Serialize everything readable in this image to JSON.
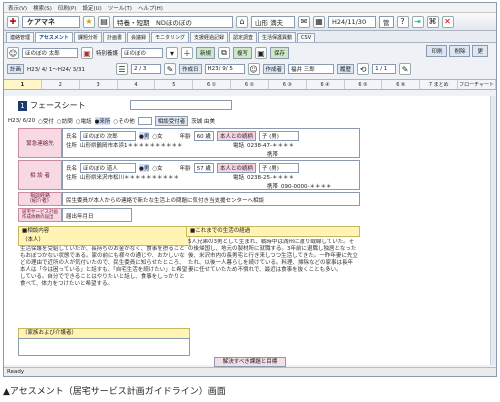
{
  "menubar": [
    "表示(V)",
    "検索(S)",
    "印刷(P)",
    "設定(U)",
    "ツール(T)",
    "ヘルプ(H)"
  ],
  "toolbar": {
    "app_title": "ケアマネ",
    "context": "特養・短期　NDほのぼの",
    "user": "山形 満夫",
    "date": "H24/11/30",
    "status": "管"
  },
  "func_tabs": [
    "連絡管理",
    "アセスメント",
    "課題分析",
    "計画書",
    "会議録",
    "モニタリング",
    "支援経過記録",
    "認定調査",
    "生活保護異動",
    "CSV"
  ],
  "actions": {
    "print": "印刷",
    "delete": "削除",
    "save": "更"
  },
  "row1": {
    "name_tag": "ほのぼの 太郎",
    "care_label": "特別養護",
    "facility": "ほのぼの",
    "new": "新規",
    "copy": "複写",
    "save": "保存"
  },
  "row2": {
    "period_label": "計画",
    "period": "H23/ 4/ 1～H24/ 3/31",
    "page": "2 / 3",
    "created_label": "作成日",
    "created": "H23/ 9/ 5",
    "author_label": "作成者",
    "author": "福井 三郎",
    "history": "履歴",
    "count": "1 / 1"
  },
  "num_tabs": [
    "1",
    "2",
    "3",
    "4",
    "5",
    "6 ①",
    "6 ②",
    "6 ③",
    "6 ④",
    "6 ⑤",
    "6 ⑥",
    "7 まとめ",
    "フローチャート"
  ],
  "sheet": {
    "title": "フェースシート",
    "date": "H23/ 6/20",
    "receipt": "受付",
    "visit": "訪問",
    "phone": "電話",
    "office": "来所",
    "other": "その他",
    "consult_label": "相談受付者",
    "consult": "茨城 由美"
  },
  "contact1": {
    "label": "緊急連絡先",
    "name_label": "氏名",
    "name": "ほのぼの 次郎",
    "male": "男",
    "female": "女",
    "age_label": "年齢",
    "age": "60 歳",
    "rel_label": "本人との続柄",
    "rel": "子 (男)",
    "addr_label": "住所",
    "addr": "山形県鶴岡市本浜1＊＊＊＊＊＊＊＊＊＊",
    "tel_label": "電話",
    "tel": "0238-47-＊＊＊＊",
    "mobile_label": "携帯"
  },
  "contact2": {
    "label": "相 談 者",
    "name_label": "氏名",
    "name": "ほのぼの 道人",
    "male": "男",
    "female": "女",
    "age_label": "年齢",
    "age": "57 歳",
    "rel_label": "本人との続柄",
    "rel": "子 (男)",
    "addr_label": "住所",
    "addr": "山形県米沢市松川＊＊＊＊＊＊＊＊＊＊",
    "tel_label": "電話",
    "tel": "0238-25-＊＊＊＊",
    "mobile_label": "携帯",
    "mobile": "090-0000-＊＊＊＊"
  },
  "route": {
    "label": "相談経路\n(紹介者)",
    "text": "民生委員が本人からの連絡で新たな生活上の問題に気付き当支援センターへ相談"
  },
  "date_field": {
    "label": "居宅サービス計画\n作成依頼の届出",
    "value": "届出年月日"
  },
  "consult_detail": {
    "header": "■相談内容",
    "sub": "（本人）",
    "text": "生活保護を受給していたが、長持ちのお金がなく、食事を摂ることもおぼつかない状態である。家の前にも様々の通じや、おかしいなどの理由で近所の人が気付いたので、民生委員に知らせたところ、本人は「今は困っている」と話すも、「自宅生活を続けたい」と希望している。自分でできることはやりたいと話し、食事をしっかりと食べて、体力をつけたいと希望する。",
    "family_header": "（家族および介護者）"
  },
  "history_section": {
    "header": "■これまでの生活の経過",
    "text": "5人兄弟の3男として生まれ、戦時中は満州に渡り戦線していた。その後帰国し、地元の製材所に就職する。3年前に退職し独居となった後、米沢市内の長男宅と行き来しつつ生活してきた。一昨年妻に先立たれ、以後一人暮らしを続けている。料理、掃除などの家事は長年妻に任せていたため不慣れで、最近は食事を抜くことも多い。"
  },
  "bottom": {
    "button": "解決すべき課題と目標"
  },
  "status": "Ready",
  "caption": "▲アセスメント（居宅サービス計画ガイドライン）画面",
  "colors": {
    "accent": "#1d3a6b",
    "pink": "#f7d9e4",
    "yellow": "#fff4b3"
  }
}
